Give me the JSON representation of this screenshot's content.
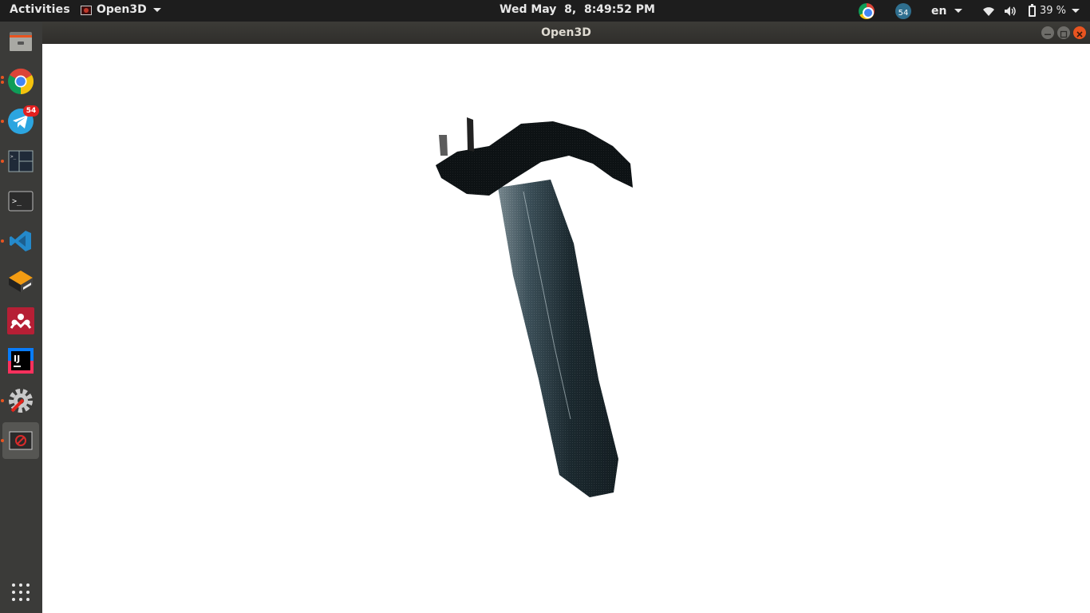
{
  "topbar": {
    "activities": "Activities",
    "app_menu": "Open3D",
    "clock": "Wed May  8,  8:49:52 PM",
    "telegram_tray_count": "54",
    "language": "en",
    "battery": "39 %"
  },
  "window": {
    "title": "Open3D"
  },
  "dock": {
    "items": [
      {
        "name": "files",
        "running": false
      },
      {
        "name": "chrome",
        "running": true
      },
      {
        "name": "telegram",
        "running": true,
        "badge": "54"
      },
      {
        "name": "terminal-split",
        "running": true
      },
      {
        "name": "terminal",
        "running": false
      },
      {
        "name": "vscode",
        "running": true
      },
      {
        "name": "sublime-merge",
        "running": false
      },
      {
        "name": "mendeley",
        "running": false
      },
      {
        "name": "intellij",
        "running": false
      },
      {
        "name": "settings",
        "running": true
      },
      {
        "name": "open3d",
        "running": true,
        "active": true
      }
    ]
  },
  "colors": {
    "accent": "#e95420",
    "badge": "#e21f1f",
    "dock_bg": "#3b3b39",
    "topbar_bg": "#1d1d1d"
  }
}
